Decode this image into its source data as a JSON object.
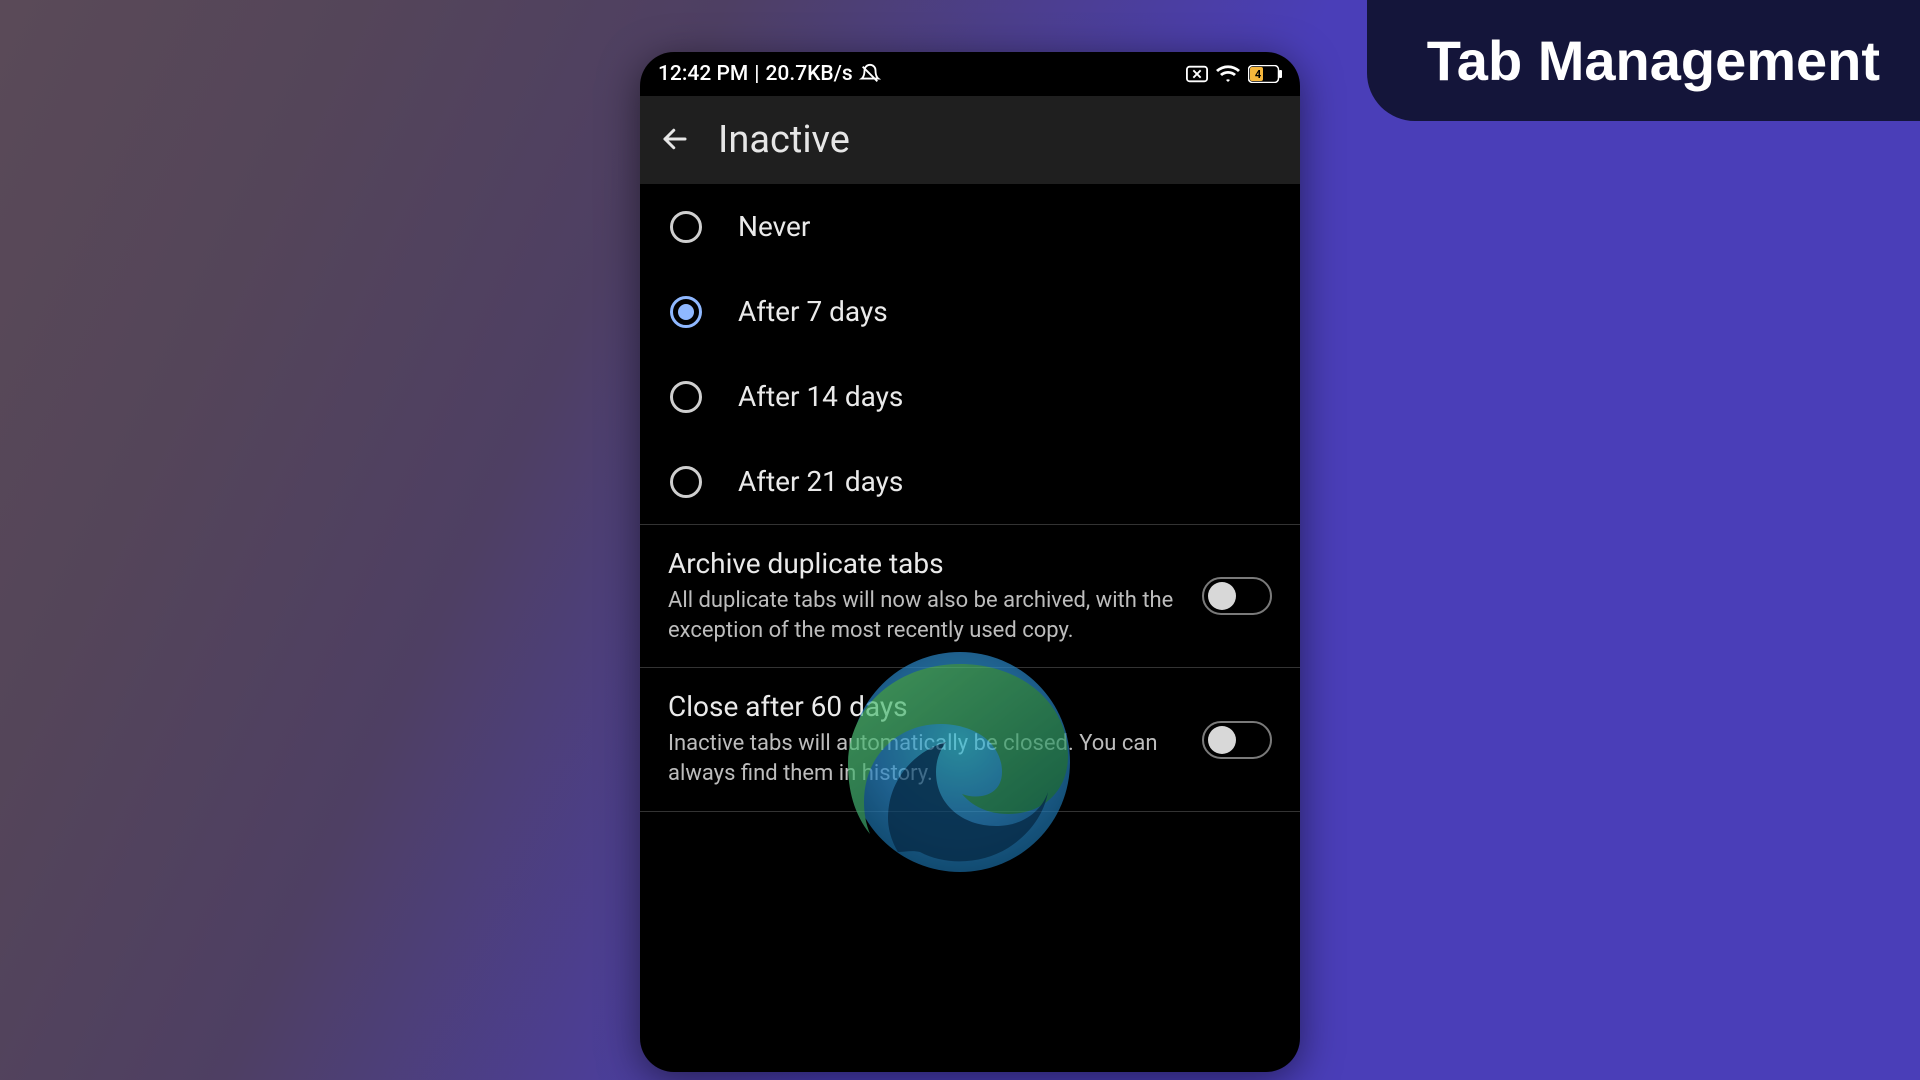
{
  "overlay": {
    "title": "Tab Management"
  },
  "statusbar": {
    "time": "12:42 PM",
    "net_speed": "20.7KB/s",
    "battery_level": "4"
  },
  "appbar": {
    "title": "Inactive"
  },
  "radio_options": [
    {
      "label": "Never",
      "selected": false
    },
    {
      "label": "After 7 days",
      "selected": true
    },
    {
      "label": "After 14 days",
      "selected": false
    },
    {
      "label": "After 21 days",
      "selected": false
    }
  ],
  "toggles": [
    {
      "title": "Archive duplicate tabs",
      "description": "All duplicate tabs will now also be archived, with the exception of the most recently used copy.",
      "enabled": false
    },
    {
      "title": "Close after 60 days",
      "description": "Inactive tabs will automatically be closed. You can always find them in history.",
      "enabled": false
    }
  ]
}
